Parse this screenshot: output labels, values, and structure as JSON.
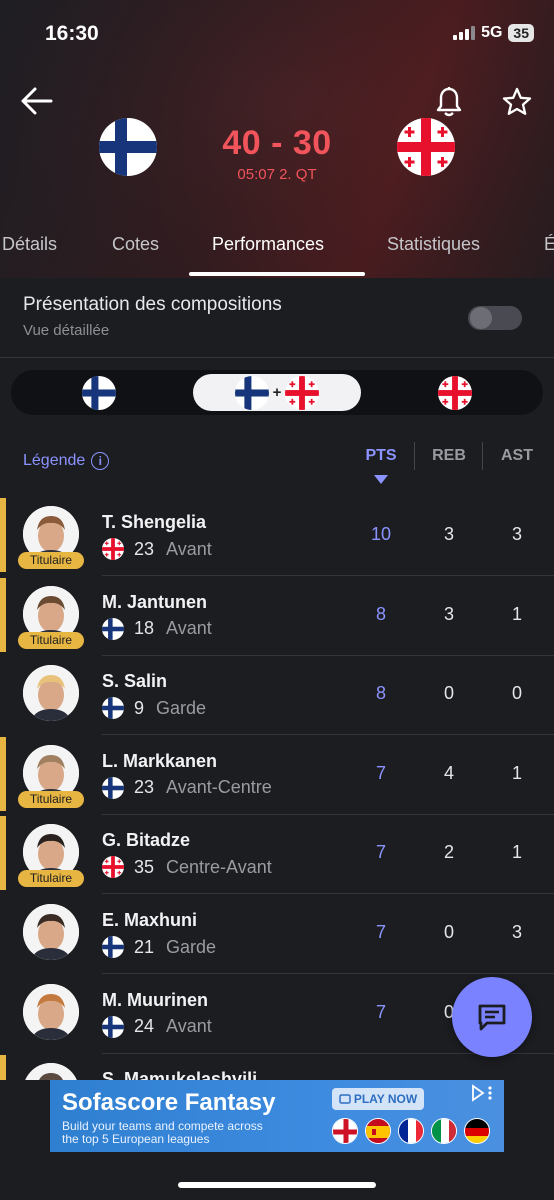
{
  "status_bar": {
    "time": "16:30",
    "network": "5G",
    "battery": "35"
  },
  "header": {
    "back_icon": "arrow-left-icon",
    "bell_icon": "bell-icon",
    "star_icon": "star-icon",
    "home_team": "Finland",
    "away_team": "Georgia",
    "score": "40 - 30",
    "clock": "05:07 2. QT",
    "score_color": "#f2545b"
  },
  "tabs": [
    "Détails",
    "Cotes",
    "Performances",
    "Statistiques",
    "É"
  ],
  "active_tab": "Performances",
  "compositions": {
    "title": "Présentation des compositions",
    "subtitle": "Vue détaillée",
    "toggle_on": false
  },
  "team_switch": {
    "both_separator": "+",
    "selected": "both"
  },
  "table": {
    "legend": "Légende",
    "info_symbol": "i",
    "columns": [
      "PTS",
      "REB",
      "AST"
    ],
    "sorted_by": "PTS",
    "accent": "#8b93ff",
    "starter_color": "#e7b542",
    "rows": [
      {
        "name": "T. Shengelia",
        "team": "geo",
        "number": "23",
        "position": "Avant",
        "pts": "10",
        "reb": "3",
        "ast": "3",
        "starter": true
      },
      {
        "name": "M. Jantunen",
        "team": "fin",
        "number": "18",
        "position": "Avant",
        "pts": "8",
        "reb": "3",
        "ast": "1",
        "starter": true
      },
      {
        "name": "S. Salin",
        "team": "fin",
        "number": "9",
        "position": "Garde",
        "pts": "8",
        "reb": "0",
        "ast": "0",
        "starter": false
      },
      {
        "name": "L. Markkanen",
        "team": "fin",
        "number": "23",
        "position": "Avant-Centre",
        "pts": "7",
        "reb": "4",
        "ast": "1",
        "starter": true
      },
      {
        "name": "G. Bitadze",
        "team": "geo",
        "number": "35",
        "position": "Centre-Avant",
        "pts": "7",
        "reb": "2",
        "ast": "1",
        "starter": true
      },
      {
        "name": "E. Maxhuni",
        "team": "fin",
        "number": "21",
        "position": "Garde",
        "pts": "7",
        "reb": "0",
        "ast": "3",
        "starter": false
      },
      {
        "name": "M. Muurinen",
        "team": "fin",
        "number": "24",
        "position": "Avant",
        "pts": "7",
        "reb": "0",
        "ast": "",
        "starter": false
      },
      {
        "name": "S. Mamukelashvili",
        "team": "geo",
        "number": "",
        "position": "",
        "pts": "",
        "reb": "",
        "ast": "",
        "starter": true
      }
    ],
    "starter_label": "Titulaire"
  },
  "fab": {
    "icon": "chat-icon"
  },
  "ad": {
    "title": "Sofascore Fantasy",
    "subtitle": "Build your teams and compete across the top 5 European leagues",
    "button": "PLAY NOW",
    "choice_icon": "ad-choices-icon"
  }
}
